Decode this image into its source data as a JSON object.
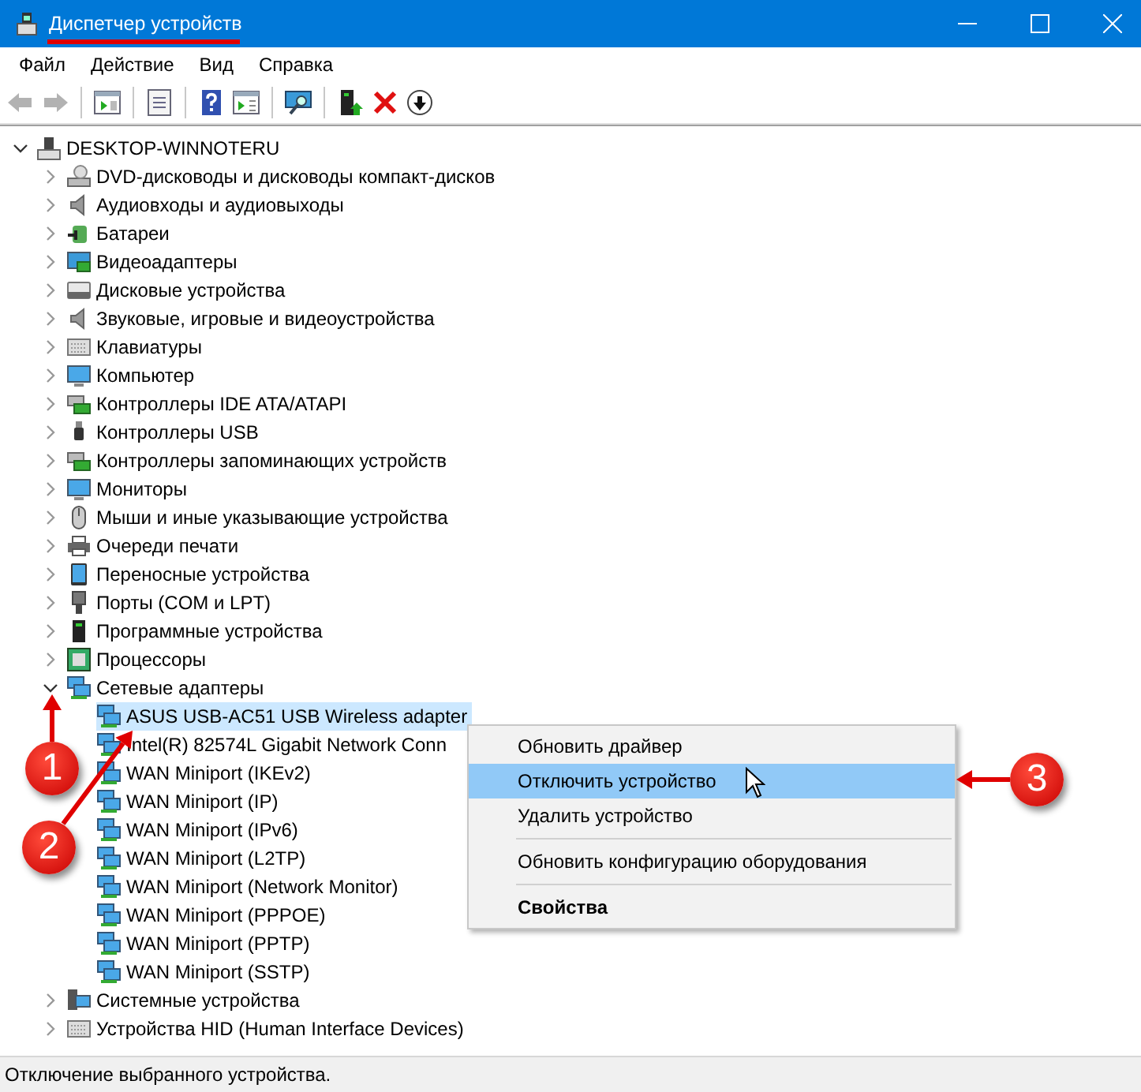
{
  "window": {
    "title": "Диспетчер устройств"
  },
  "menu_bar": [
    "Файл",
    "Действие",
    "Вид",
    "Справка"
  ],
  "toolbar": [
    [
      {
        "kind": "back",
        "disabled": true
      },
      {
        "kind": "forward",
        "disabled": true
      }
    ],
    [
      {
        "kind": "tree",
        "disabled": false
      }
    ],
    [
      {
        "kind": "properties",
        "disabled": false
      }
    ],
    [
      {
        "kind": "help",
        "disabled": false
      },
      {
        "kind": "view",
        "disabled": false
      }
    ],
    [
      {
        "kind": "scan",
        "disabled": false
      }
    ],
    [
      {
        "kind": "update",
        "disabled": false
      },
      {
        "kind": "remove",
        "disabled": false
      },
      {
        "kind": "disable",
        "disabled": false
      }
    ]
  ],
  "tree": [
    {
      "label": "DESKTOP-WINNOTERU",
      "kind": "computer",
      "expanded": true,
      "selected": false,
      "children": [
        {
          "label": "DVD-дисководы и дисководы компакт-дисков",
          "kind": "dvd",
          "expanded": false,
          "selected": false
        },
        {
          "label": "Аудиовходы и аудиовыходы",
          "kind": "audio",
          "expanded": false,
          "selected": false
        },
        {
          "label": "Батареи",
          "kind": "battery",
          "expanded": false,
          "selected": false
        },
        {
          "label": "Видеоадаптеры",
          "kind": "display",
          "expanded": false,
          "selected": false
        },
        {
          "label": "Дисковые устройства",
          "kind": "disk",
          "expanded": false,
          "selected": false
        },
        {
          "label": "Звуковые, игровые и видеоустройства",
          "kind": "audio",
          "expanded": false,
          "selected": false
        },
        {
          "label": "Клавиатуры",
          "kind": "keyboard",
          "expanded": false,
          "selected": false
        },
        {
          "label": "Компьютер",
          "kind": "monitor",
          "expanded": false,
          "selected": false
        },
        {
          "label": "Контроллеры IDE ATA/ATAPI",
          "kind": "card",
          "expanded": false,
          "selected": false
        },
        {
          "label": "Контроллеры USB",
          "kind": "usb",
          "expanded": false,
          "selected": false
        },
        {
          "label": "Контроллеры запоминающих устройств",
          "kind": "card",
          "expanded": false,
          "selected": false
        },
        {
          "label": "Мониторы",
          "kind": "monitor",
          "expanded": false,
          "selected": false
        },
        {
          "label": "Мыши и иные указывающие устройства",
          "kind": "mouse",
          "expanded": false,
          "selected": false
        },
        {
          "label": "Очереди печати",
          "kind": "printer",
          "expanded": false,
          "selected": false
        },
        {
          "label": "Переносные устройства",
          "kind": "portable",
          "expanded": false,
          "selected": false
        },
        {
          "label": "Порты (COM и LPT)",
          "kind": "port",
          "expanded": false,
          "selected": false
        },
        {
          "label": "Программные устройства",
          "kind": "tower",
          "expanded": false,
          "selected": false
        },
        {
          "label": "Процессоры",
          "kind": "cpu",
          "expanded": false,
          "selected": false
        },
        {
          "label": "Сетевые адаптеры",
          "kind": "network",
          "expanded": true,
          "selected": false,
          "children": [
            {
              "label": "ASUS USB-AC51 USB Wireless adapter",
              "kind": "network",
              "selected": true
            },
            {
              "label": "Intel(R) 82574L Gigabit Network Conn",
              "kind": "network",
              "selected": false
            },
            {
              "label": "WAN Miniport (IKEv2)",
              "kind": "network",
              "selected": false
            },
            {
              "label": "WAN Miniport (IP)",
              "kind": "network",
              "selected": false
            },
            {
              "label": "WAN Miniport (IPv6)",
              "kind": "network",
              "selected": false
            },
            {
              "label": "WAN Miniport (L2TP)",
              "kind": "network",
              "selected": false
            },
            {
              "label": "WAN Miniport (Network Monitor)",
              "kind": "network",
              "selected": false
            },
            {
              "label": "WAN Miniport (PPPOE)",
              "kind": "network",
              "selected": false
            },
            {
              "label": "WAN Miniport (PPTP)",
              "kind": "network",
              "selected": false
            },
            {
              "label": "WAN Miniport (SSTP)",
              "kind": "network",
              "selected": false
            }
          ]
        },
        {
          "label": "Системные устройства",
          "kind": "system",
          "expanded": false,
          "selected": false
        },
        {
          "label": "Устройства HID (Human Interface Devices)",
          "kind": "keyboard",
          "expanded": false,
          "selected": false
        }
      ]
    }
  ],
  "context_menu": [
    {
      "label": "Обновить драйвер",
      "selected": false,
      "bold": false,
      "separator_before": false
    },
    {
      "label": "Отключить устройство",
      "selected": true,
      "bold": false,
      "separator_before": false
    },
    {
      "label": "Удалить устройство",
      "selected": false,
      "bold": false,
      "separator_before": false
    },
    {
      "label": "Обновить конфигурацию оборудования",
      "selected": false,
      "bold": false,
      "separator_before": true
    },
    {
      "label": "Свойства",
      "selected": false,
      "bold": true,
      "separator_before": true
    }
  ],
  "annotations": [
    {
      "number": "1"
    },
    {
      "number": "2"
    },
    {
      "number": "3"
    }
  ],
  "status_bar": "Отключение выбранного устройства."
}
